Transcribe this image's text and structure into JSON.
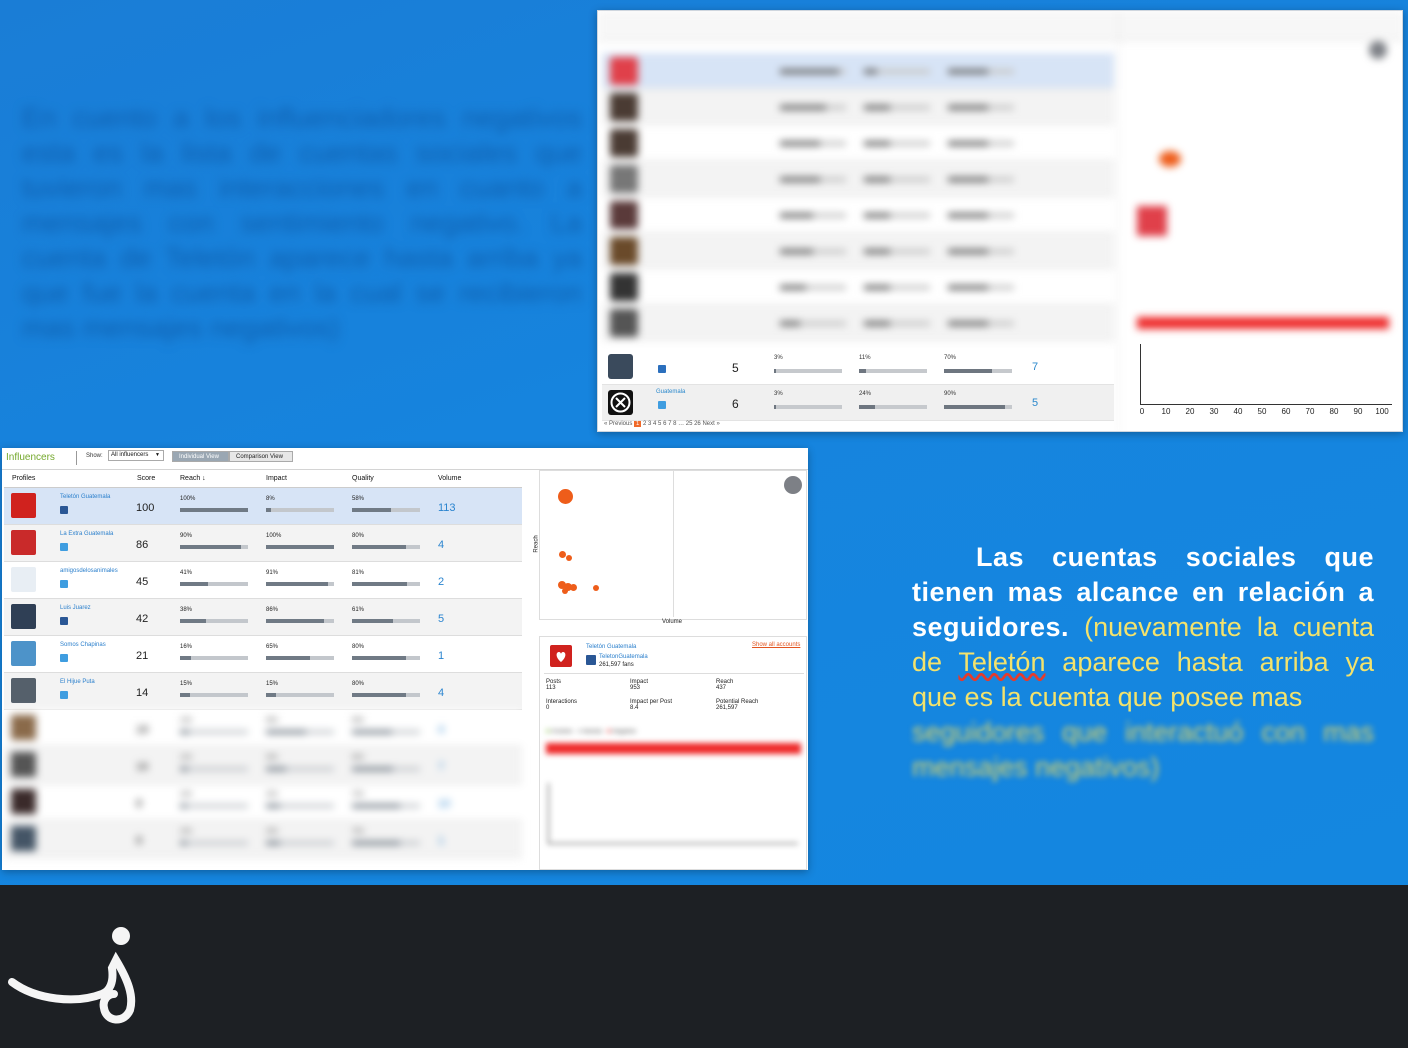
{
  "right_text": {
    "strong": "Las cuentas sociales que tienen mas alcance en relación a seguidores.",
    "yellow_1": "(nuevamente la cuenta de ",
    "yellow_underlined": "Teletón",
    "yellow_2": " aparece hasta arriba ya que es la cuenta que posee mas",
    "faded": "seguidores que interactuó con mas mensajes negativos)"
  },
  "top_screenshot": {
    "rows": [
      {
        "score": "5",
        "reach": "3%",
        "impact": "11%",
        "quality": "70%",
        "volume": "7",
        "reach_fill": 0.03,
        "impact_fill": 0.11,
        "quality_fill": 0.7
      },
      {
        "name": "Guatemala",
        "score": "6",
        "reach": "3%",
        "impact": "24%",
        "quality": "90%",
        "volume": "5",
        "reach_fill": 0.03,
        "impact_fill": 0.24,
        "quality_fill": 0.9
      }
    ],
    "pager": {
      "prev": "« Previous",
      "current": "1",
      "pages": "2 3 4 5 6 7 8 … 25 26",
      "next": "Next »"
    },
    "axis_ticks": [
      "0",
      "10",
      "20",
      "30",
      "40",
      "50",
      "60",
      "70",
      "80",
      "90",
      "100"
    ]
  },
  "main_screenshot": {
    "brand": "Influencers",
    "show_label": "Show:",
    "show_value": "All influencers",
    "tabs": {
      "individual": "Individual View",
      "comparison": "Comparison View"
    },
    "headers": {
      "profiles": "Profiles",
      "score": "Score",
      "reach": "Reach ↓",
      "impact": "Impact",
      "quality": "Quality",
      "volume": "Volume"
    },
    "rows": [
      {
        "name": "Teletón Guatemala",
        "network": "facebook",
        "score": "100",
        "reach": "100%",
        "impact": "8%",
        "quality": "58%",
        "volume": "113",
        "reach_fill": 1.0,
        "impact_fill": 0.08,
        "quality_fill": 0.58,
        "avatar_color": "#d0221e"
      },
      {
        "name": "La Extra Guatemala",
        "network": "twitter",
        "score": "86",
        "reach": "90%",
        "impact": "100%",
        "quality": "80%",
        "volume": "4",
        "reach_fill": 0.9,
        "impact_fill": 1.0,
        "quality_fill": 0.8,
        "avatar_color": "#c92a2a"
      },
      {
        "name": "amigosdelosanimales",
        "network": "twitter",
        "score": "45",
        "reach": "41%",
        "impact": "91%",
        "quality": "81%",
        "volume": "2",
        "reach_fill": 0.41,
        "impact_fill": 0.91,
        "quality_fill": 0.81,
        "avatar_color": "#e8eef4"
      },
      {
        "name": "Luis Juarez",
        "network": "facebook",
        "score": "42",
        "reach": "38%",
        "impact": "86%",
        "quality": "61%",
        "volume": "5",
        "reach_fill": 0.38,
        "impact_fill": 0.86,
        "quality_fill": 0.61,
        "avatar_color": "#2f3f55"
      },
      {
        "name": "Somos Chapinas",
        "network": "twitter",
        "score": "21",
        "reach": "16%",
        "impact": "65%",
        "quality": "80%",
        "volume": "1",
        "reach_fill": 0.16,
        "impact_fill": 0.65,
        "quality_fill": 0.8,
        "avatar_color": "#4d93c9"
      },
      {
        "name": "El Hijue Puta",
        "network": "twitter",
        "score": "14",
        "reach": "15%",
        "impact": "15%",
        "quality": "80%",
        "volume": "4",
        "reach_fill": 0.15,
        "impact_fill": 0.15,
        "quality_fill": 0.8,
        "avatar_color": "#55606b"
      }
    ],
    "detail": {
      "name": "Teletón Guatemala",
      "handle": "TeletonGuatemala",
      "fans": "261,597 fans",
      "show_all": "Show all accounts",
      "posts_label": "Posts",
      "posts": "113",
      "impact_label": "Impact",
      "impact": "953",
      "reach_label": "Reach",
      "reach": "437",
      "interactions_label": "Interactions",
      "interactions": "0",
      "ipp_label": "Impact per Post",
      "ipp": "8.4",
      "potential_label": "Potential Reach",
      "potential": "261,597"
    },
    "chart": {
      "y_label": "Reach",
      "x_label": "Volume"
    }
  },
  "colors": {
    "accent_orange": "#ee5d1a",
    "brand_green": "#74a82c",
    "link_blue": "#2a7fcc",
    "slide_blue": "#1684de"
  }
}
